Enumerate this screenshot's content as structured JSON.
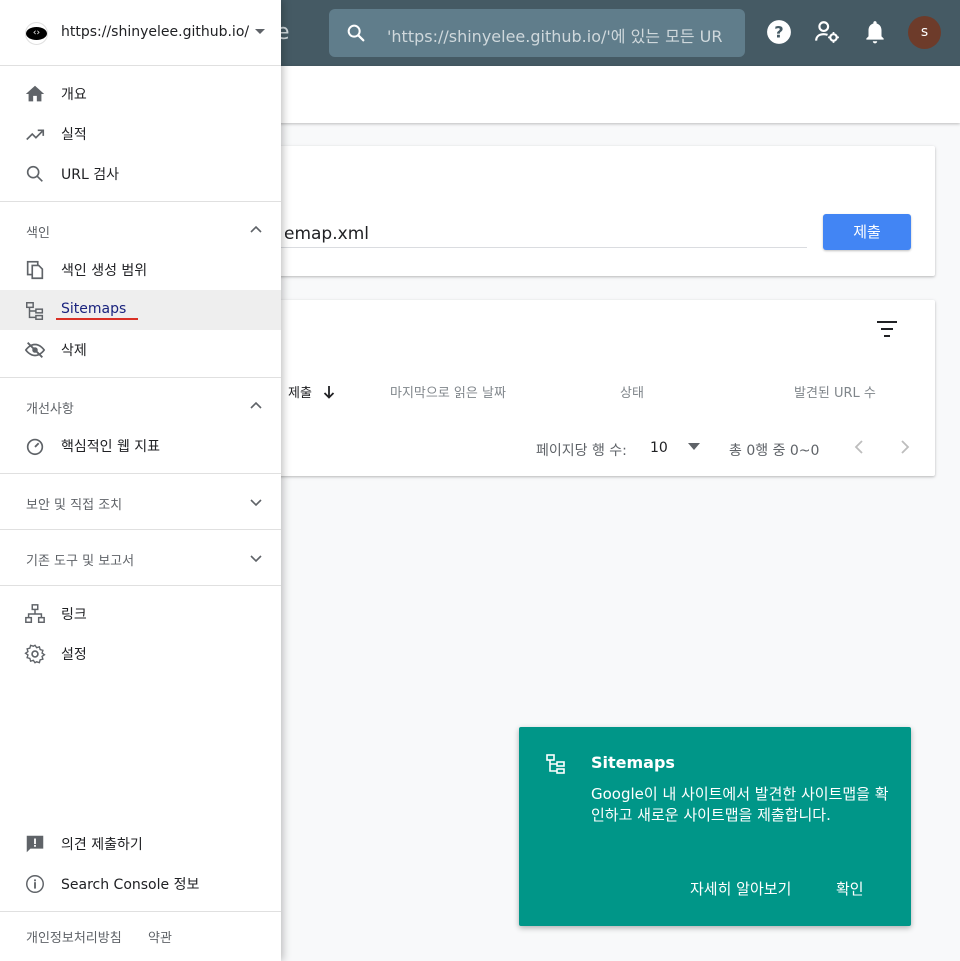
{
  "colors": {
    "topbar": "#455a64",
    "search_bg": "#607d8b",
    "accent_blue": "#4285f4",
    "snackbar": "#009688",
    "active_underline": "#d93025",
    "avatar": "#6d3b2a"
  },
  "topbar": {
    "brand_tail": "e",
    "search_placeholder": "'https://shinyelee.github.io/'에 있는 모든 UR",
    "icons": [
      "help-icon",
      "manage-users-icon",
      "notifications-icon"
    ],
    "avatar_letter": "s"
  },
  "sidebar": {
    "property": "https://shinyelee.github.io/",
    "items_top": [
      {
        "icon": "home-icon",
        "label": "개요"
      },
      {
        "icon": "trending-up-icon",
        "label": "실적"
      },
      {
        "icon": "search-icon",
        "label": "URL 검사"
      }
    ],
    "section_index": {
      "label": "색인",
      "items": [
        {
          "icon": "copy-pages-icon",
          "label": "색인 생성 범위"
        },
        {
          "icon": "sitemap-icon",
          "label": "Sitemaps"
        },
        {
          "icon": "visibility-off-icon",
          "label": "삭제"
        }
      ]
    },
    "section_enhancements": {
      "label": "개선사항",
      "items": [
        {
          "icon": "speed-gauge-icon",
          "label": "핵심적인 웹 지표"
        }
      ]
    },
    "section_security": {
      "label": "보안 및 직접 조치"
    },
    "section_legacy": {
      "label": "기존 도구 및 보고서"
    },
    "items_bottom": [
      {
        "icon": "links-icon",
        "label": "링크"
      },
      {
        "icon": "settings-gear-icon",
        "label": "설정"
      }
    ],
    "items_footer": [
      {
        "icon": "feedback-icon",
        "label": "의견 제출하기"
      },
      {
        "icon": "info-icon",
        "label": "Search Console 정보"
      }
    ],
    "footer_links": [
      "개인정보처리방침",
      "약관"
    ]
  },
  "add_sitemap": {
    "url_value": "emap.xml",
    "submit_label": "제출"
  },
  "submitted_table": {
    "columns": [
      "제출",
      "마지막으로 읽은 날짜",
      "상태",
      "발견된 URL 수"
    ],
    "rows_per_page_label": "페이지당 행 수:",
    "rows_per_page": "10",
    "range_label": "총 0행 중 0~0"
  },
  "snackbar": {
    "title": "Sitemaps",
    "body": "Google이 내 사이트에서 발견한 사이트맵을 확인하고 새로운 사이트맵을 제출합니다.",
    "learn_more": "자세히 알아보기",
    "ok": "확인"
  }
}
